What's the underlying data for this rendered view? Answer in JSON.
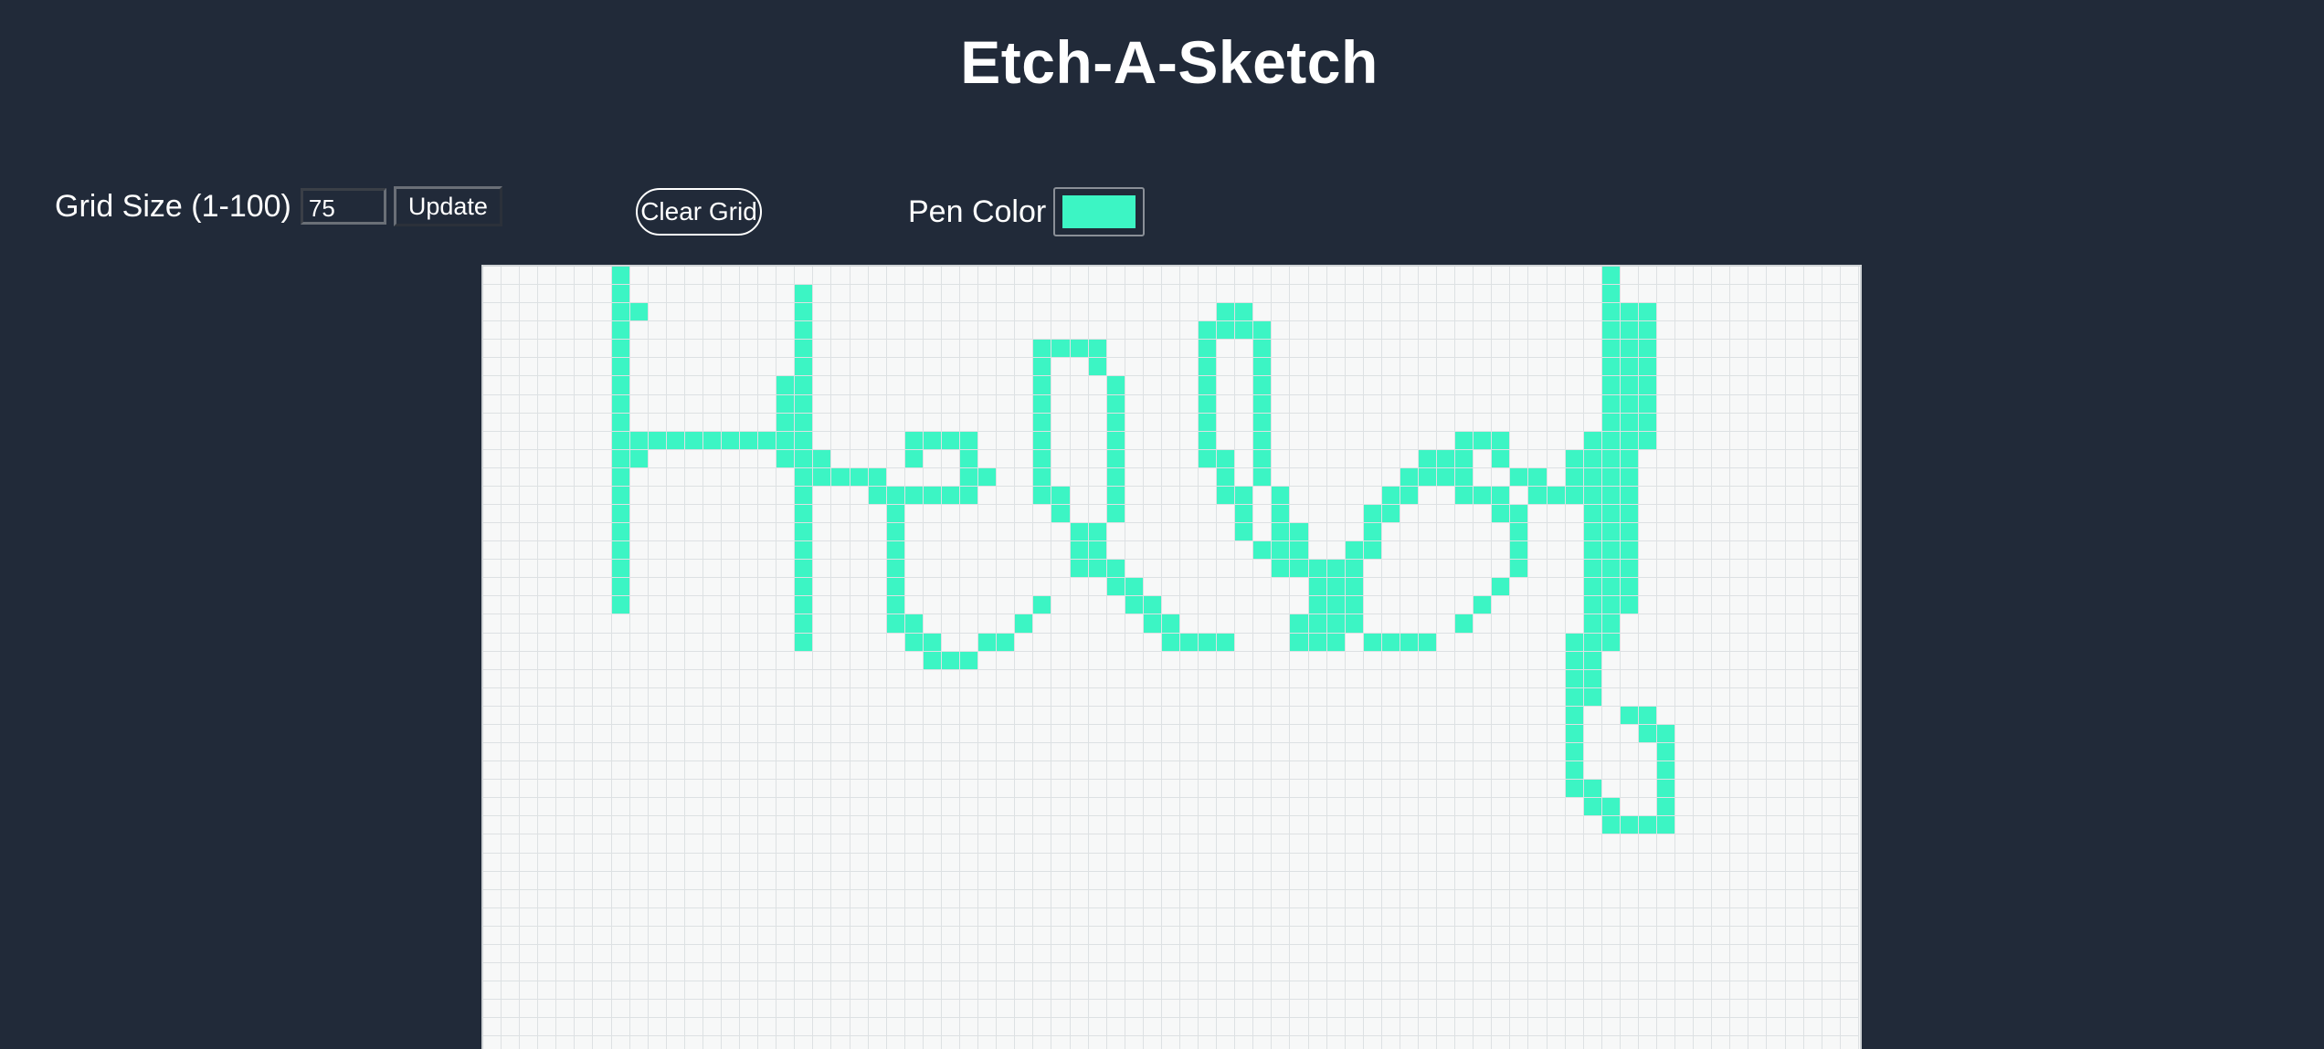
{
  "title": "Etch-A-Sketch",
  "grid_size": {
    "label": "Grid Size (1-100)",
    "value": "75",
    "update_label": "Update"
  },
  "clear_label": "Clear Grid",
  "pen": {
    "label": "Pen Color",
    "color": "#3cf5c4"
  },
  "colors": {
    "background": "#212a39",
    "cell": "#f7f8f8"
  },
  "grid": {
    "columns": 75,
    "drawing": [
      "0:7",
      "1:7",
      "2:7-8",
      "3:7",
      "4:7",
      "5:7",
      "6:7",
      "7:7",
      "8:7",
      "9:7-9,17",
      "10:7-8,17",
      "11:7",
      "12:7",
      "13:7",
      "14:7",
      "15:7",
      "16:7",
      "17:7",
      "18:7",
      "1:17",
      "2:17",
      "3:17",
      "4:17",
      "5:17",
      "6:16-17",
      "7:16-17",
      "8:16-17",
      "9:8-16",
      "10:16-18",
      "11:17-21",
      "12:17,21-26",
      "13:17,22",
      "14:17",
      "15:17",
      "16:17",
      "17:17",
      "18:17",
      "19:17",
      "20:17",
      "9:23-26",
      "10:23,26",
      "11:26-27",
      "12:22-26",
      "13:22",
      "14:22",
      "15:22",
      "16:22",
      "17:22",
      "18:22",
      "19:22-23",
      "20:23-24",
      "21:24-26",
      "20:27-28",
      "19:29",
      "18:30",
      "4:30-33",
      "5:30,33",
      "6:30,34",
      "7:30,34",
      "8:30,34",
      "9:30,34",
      "10:30,34",
      "11:30,34",
      "12:30-31,34",
      "13:31,34",
      "14:32-33",
      "15:32-33",
      "16:32-34",
      "17:34-35",
      "18:35-36",
      "19:36-37",
      "20:37-40",
      "2:40-41",
      "3:39-42",
      "4:39,42",
      "5:39,42",
      "6:39,42",
      "7:39,42",
      "8:39,42",
      "9:39,42",
      "10:39-40,42",
      "11:40,42",
      "12:40-41,43",
      "13:41,43",
      "14:41,43-44",
      "15:42-44",
      "16:43-46",
      "17:45-47",
      "18:45-47",
      "19:44-47",
      "20:44-46",
      "9:53-55",
      "10:51-53,55",
      "11:50-53,56-57",
      "12:49-50,53-55,57-59",
      "13:48-49,55-56",
      "14:48,56",
      "15:47-48,56",
      "16:47,56",
      "17:47,55",
      "18:46-47,54",
      "19:47,53",
      "20:48-51",
      "0:61",
      "1:61",
      "2:61-63",
      "3:61-63",
      "4:61-63",
      "5:61-63",
      "6:61-63",
      "7:61-63",
      "8:61-63",
      "9:60-63",
      "10:59-62",
      "11:59-62",
      "12:60-62",
      "13:60-62",
      "14:60-62",
      "15:60-62",
      "16:60-62",
      "17:60-62",
      "18:60-62",
      "19:60-61",
      "20:59-61",
      "21:59-60",
      "22:59-60",
      "23:59-60",
      "24:59,62-63",
      "25:59,63-64",
      "26:59,64",
      "27:59,64",
      "28:59-60,64",
      "29:60-61,64",
      "30:61-64"
    ]
  }
}
